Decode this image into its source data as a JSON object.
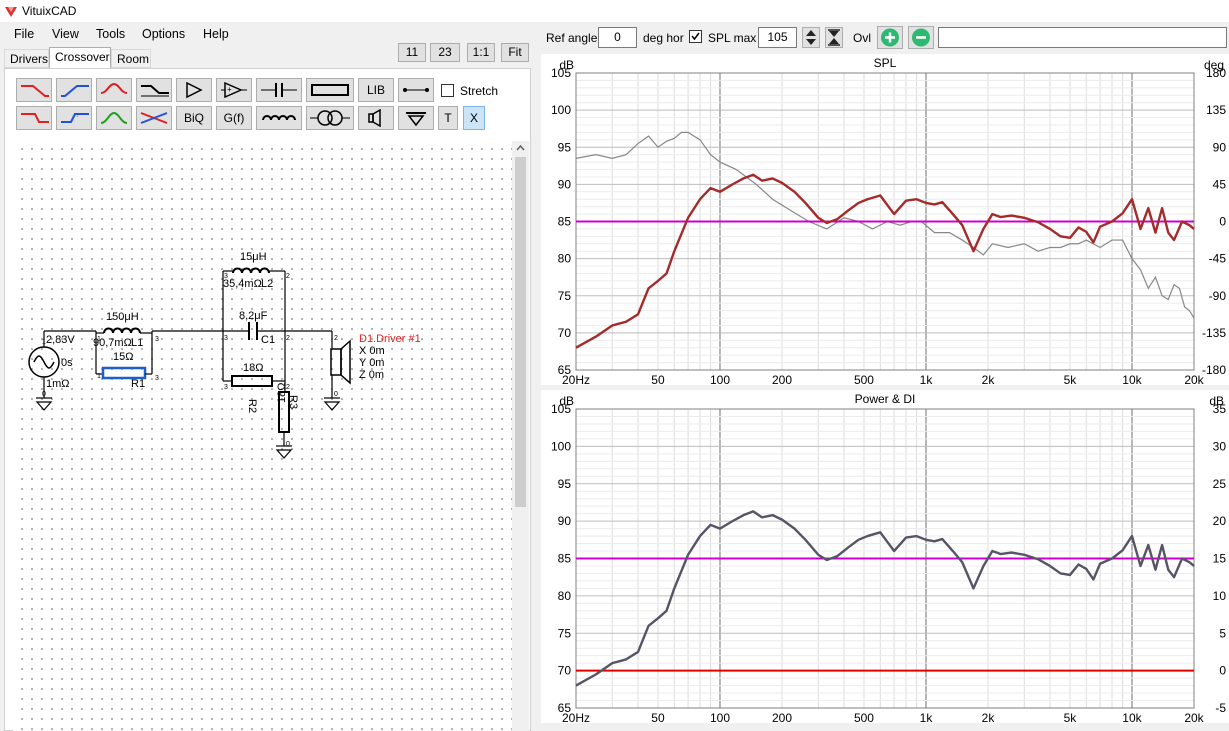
{
  "app": {
    "title": "VituixCAD"
  },
  "menu": [
    "File",
    "View",
    "Tools",
    "Options",
    "Help"
  ],
  "tabs": [
    "Drivers",
    "Crossover",
    "Room"
  ],
  "view_buttons": [
    "11",
    "23",
    "1:1",
    "Fit"
  ],
  "toolbar": {
    "lib": "LIB",
    "biq": "BiQ",
    "gf": "G(f)",
    "t": "T",
    "x": "X",
    "stretch": "Stretch",
    "stretch_checked": false
  },
  "controls": {
    "ref_angle_label": "Ref angle",
    "ref_angle_value": "0",
    "deg_hor": "deg hor",
    "spl_max_checked": true,
    "spl_max_label": "SPL max",
    "spl_max_value": "105",
    "ovl_label": "Ovl",
    "text_field": ""
  },
  "schematic": {
    "source_voltage": "2,83V",
    "source_delay": "0s",
    "source_impedance": "1mΩ",
    "l1_value": "150μH",
    "l1_resistance": "90,7mΩ",
    "l1_name": "L1",
    "r1_value": "15Ω",
    "r1_name": "R1",
    "l2_value": "15μH",
    "l2_resistance": "35,4mΩ",
    "l2_name": "L2",
    "c1_value": "8,2μF",
    "c1_name": "C1",
    "r2_value": "18Ω",
    "r2_name": "R2",
    "r3_value": "18Ω",
    "r3_name": "R3",
    "driver_name": "D1.Driver #1",
    "driver_x": "X 0m",
    "driver_y": "Y 0m",
    "driver_z": "Z 0m"
  },
  "colors": {
    "spl_curve": "#a52a2a",
    "reference_line": "#cc00cc",
    "di_line": "#e00000",
    "power_curve": "#555566",
    "offaxis": "#888888"
  },
  "chart_data": [
    {
      "type": "line",
      "title": "SPL",
      "ylabel": "dB",
      "y2label": "deg",
      "xscale": "log",
      "xlim": [
        20,
        20000
      ],
      "ylim": [
        65,
        105
      ],
      "y2lim": [
        -180,
        180
      ],
      "x_ticks": [
        "20Hz",
        "50",
        "100",
        "200",
        "500",
        "1k",
        "2k",
        "5k",
        "10k",
        "20k"
      ],
      "y_ticks": [
        "65",
        "70",
        "75",
        "80",
        "85",
        "90",
        "95",
        "100",
        "105"
      ],
      "y2_ticks": [
        "-180",
        "-135",
        "-90",
        "-45",
        "0",
        "45",
        "90",
        "135",
        "180"
      ],
      "grid": true,
      "reference_line": 85,
      "series": [
        {
          "x": [
            20,
            25,
            30,
            35,
            40,
            45,
            50,
            55,
            60,
            70,
            80,
            90,
            100,
            115,
            130,
            145,
            160,
            180,
            200,
            230,
            260,
            300,
            330,
            370,
            420,
            470,
            520,
            600,
            700,
            800,
            900,
            1000,
            1100,
            1200,
            1350,
            1500,
            1700,
            1900,
            2100,
            2300,
            2600,
            3000,
            3500,
            4000,
            4500,
            5000,
            5500,
            6000,
            6500,
            7000,
            8000,
            9000,
            10000,
            11000,
            12000,
            13000,
            14000,
            15000,
            16000,
            17500,
            19000,
            20000
          ],
          "y": [
            68.0,
            69.5,
            71.0,
            71.5,
            72.5,
            76.0,
            77.0,
            78.0,
            81.0,
            85.5,
            88.0,
            89.5,
            89.0,
            90.0,
            90.8,
            91.3,
            90.5,
            90.8,
            90.2,
            89.0,
            87.5,
            85.5,
            84.8,
            85.3,
            86.5,
            87.5,
            88.0,
            88.5,
            86.0,
            87.8,
            88.0,
            87.5,
            87.3,
            87.6,
            86.0,
            84.5,
            81.0,
            84.0,
            86.0,
            85.6,
            85.8,
            85.5,
            84.9,
            84.0,
            83.0,
            82.8,
            84.2,
            83.6,
            82.2,
            84.3,
            85.0,
            86.1,
            88.0,
            84.0,
            86.8,
            83.5,
            86.8,
            83.5,
            82.5,
            85.0,
            84.5,
            84.0
          ]
        },
        {
          "x": [
            20,
            25,
            30,
            35,
            40,
            45,
            50,
            55,
            60,
            65,
            70,
            80,
            90,
            100,
            120,
            150,
            180,
            220,
            270,
            330,
            400,
            470,
            550,
            650,
            750,
            850,
            950,
            1100,
            1300,
            1500,
            1700,
            1900,
            2100,
            2500,
            3000,
            3500,
            4000,
            4500,
            5000,
            5500,
            6000,
            7000,
            8000,
            9000,
            10000,
            11000,
            12000,
            13000,
            14000,
            15000,
            16000,
            17000,
            18000,
            19000,
            20000
          ],
          "y": [
            93.5,
            94.0,
            93.5,
            94.0,
            95.5,
            96.5,
            95.0,
            95.8,
            96.2,
            97.0,
            97.0,
            96.0,
            94.0,
            93.0,
            92.0,
            90.0,
            88.0,
            86.5,
            85.0,
            84.0,
            85.5,
            85.0,
            84.0,
            85.0,
            84.5,
            85.0,
            85.0,
            83.5,
            83.5,
            82.5,
            81.5,
            80.5,
            82.0,
            81.5,
            82.0,
            81.0,
            81.5,
            81.5,
            82.0,
            82.0,
            82.5,
            81.5,
            82.5,
            82.5,
            80.0,
            78.5,
            76.0,
            77.5,
            75.0,
            74.5,
            76.5,
            76.0,
            73.5,
            73.0,
            72.0
          ]
        }
      ]
    },
    {
      "type": "line",
      "title": "Power & DI",
      "ylabel": "dB",
      "y2label": "dB",
      "xscale": "log",
      "xlim": [
        20,
        20000
      ],
      "ylim": [
        65,
        105
      ],
      "y2lim": [
        -5,
        35
      ],
      "x_ticks": [
        "20Hz",
        "50",
        "100",
        "200",
        "500",
        "1k",
        "2k",
        "5k",
        "10k",
        "20k"
      ],
      "y_ticks": [
        "65",
        "70",
        "75",
        "80",
        "85",
        "90",
        "95",
        "100",
        "105"
      ],
      "y2_ticks": [
        "-5",
        "0",
        "5",
        "10",
        "15",
        "20",
        "25",
        "30",
        "35"
      ],
      "grid": true,
      "reference_line": 85,
      "di_line": 70,
      "series": [
        {
          "x": [
            20,
            25,
            30,
            35,
            40,
            45,
            50,
            55,
            60,
            70,
            80,
            90,
            100,
            115,
            130,
            145,
            160,
            180,
            200,
            230,
            260,
            300,
            330,
            370,
            420,
            470,
            520,
            600,
            700,
            800,
            900,
            1000,
            1100,
            1200,
            1350,
            1500,
            1700,
            1900,
            2100,
            2300,
            2600,
            3000,
            3500,
            4000,
            4500,
            5000,
            5500,
            6000,
            6500,
            7000,
            8000,
            9000,
            10000,
            11000,
            12000,
            13000,
            14000,
            15000,
            16000,
            17500,
            19000,
            20000
          ],
          "y": [
            68.0,
            69.5,
            71.0,
            71.5,
            72.5,
            76.0,
            77.0,
            78.0,
            81.0,
            85.5,
            88.0,
            89.5,
            89.0,
            90.0,
            90.8,
            91.3,
            90.5,
            90.8,
            90.2,
            89.0,
            87.5,
            85.5,
            84.8,
            85.3,
            86.5,
            87.5,
            88.0,
            88.5,
            86.0,
            87.8,
            88.0,
            87.5,
            87.3,
            87.6,
            86.0,
            84.5,
            81.0,
            84.0,
            86.0,
            85.6,
            85.8,
            85.5,
            84.9,
            84.0,
            83.0,
            82.8,
            84.2,
            83.6,
            82.2,
            84.3,
            85.0,
            86.1,
            88.0,
            84.0,
            86.8,
            83.5,
            86.8,
            83.5,
            82.5,
            85.0,
            84.5,
            84.0
          ]
        }
      ]
    }
  ]
}
